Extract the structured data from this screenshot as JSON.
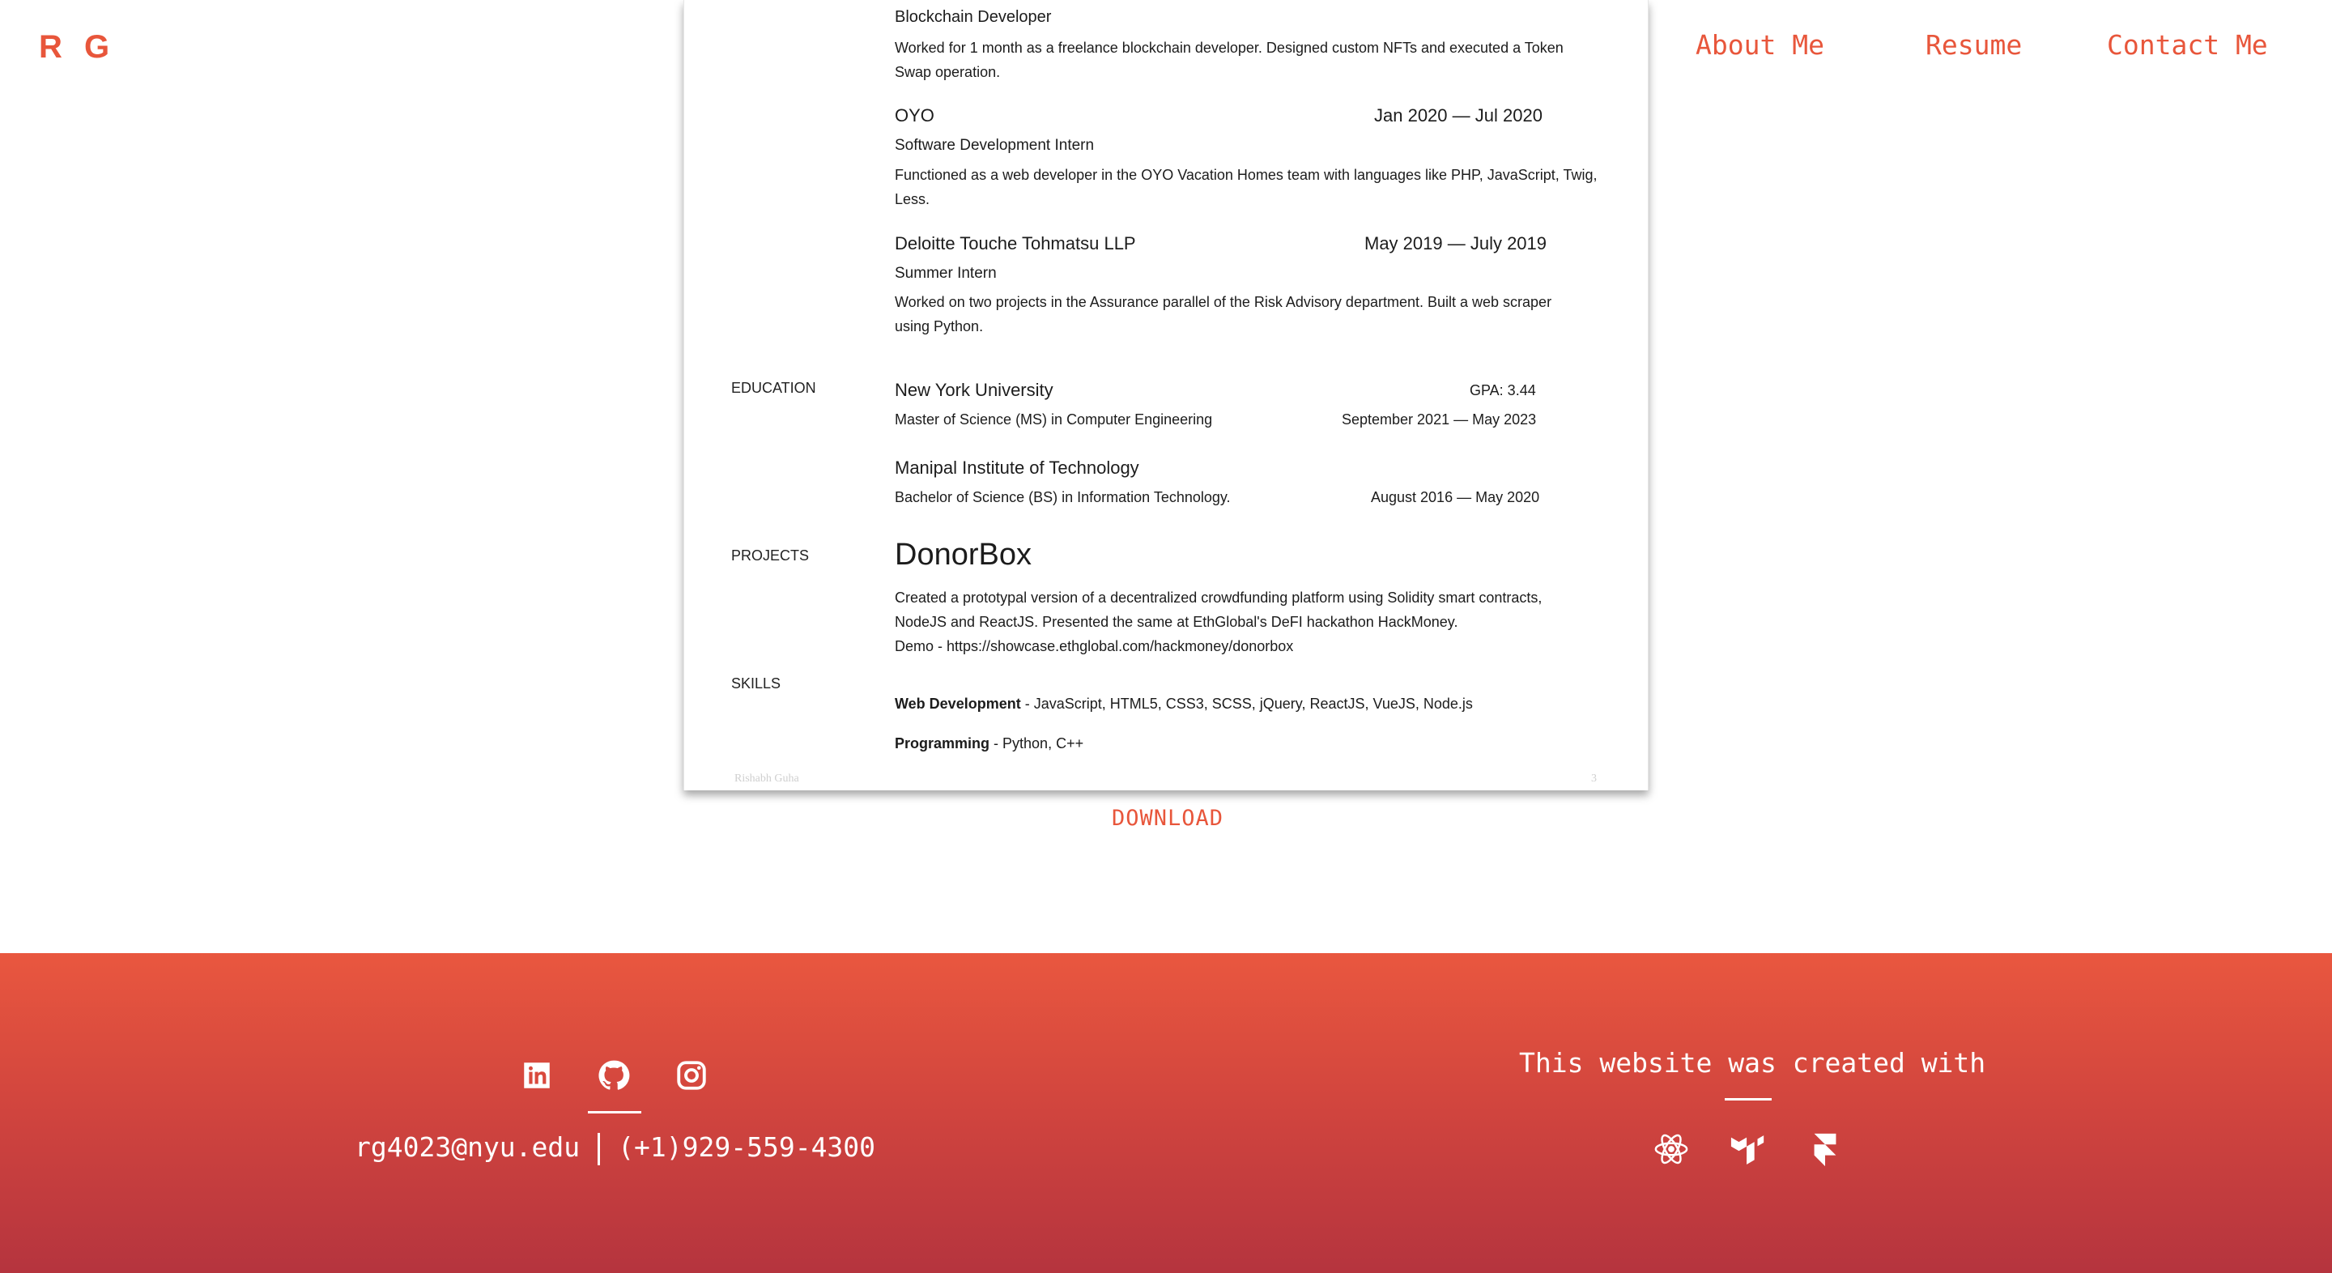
{
  "header": {
    "logo": "R G",
    "nav": [
      "About Me",
      "Resume",
      "Contact Me"
    ]
  },
  "resume": {
    "exp_blockchain": {
      "title": "Blockchain Developer",
      "desc": "Worked for 1 month as a freelance blockchain developer. Designed custom NFTs and executed a Token Swap operation."
    },
    "exp_oyo": {
      "company": "OYO",
      "dates": "Jan 2020 — Jul 2020",
      "title": "Software Development Intern",
      "desc": "Functioned as a web developer in the OYO Vacation Homes team with languages like PHP, JavaScript, Twig, Less."
    },
    "exp_deloitte": {
      "company": "Deloitte Touche Tohmatsu LLP",
      "dates": "May 2019 — July 2019",
      "title": "Summer Intern",
      "desc": "Worked on two projects in the Assurance parallel of the Risk Advisory department. Built a web scraper using Python."
    },
    "education_label": "EDUCATION",
    "edu_nyu": {
      "school": "New York University",
      "gpa": "GPA: 3.44",
      "degree": "Master of Science (MS) in Computer Engineering",
      "dates": "September 2021 — May 2023"
    },
    "edu_manipal": {
      "school": "Manipal Institute of Technology",
      "degree": "Bachelor of Science (BS) in Information Technology.",
      "dates": "August 2016 — May 2020"
    },
    "projects_label": "PROJECTS",
    "project": {
      "name": "DonorBox",
      "line1": "Created a prototypal version of a decentralized crowdfunding platform using Solidity smart contracts,",
      "line2": "NodeJS and ReactJS. Presented the same at EthGlobal's DeFI hackathon HackMoney.",
      "line3": "Demo - https://showcase.ethglobal.com/hackmoney/donorbox"
    },
    "skills_label": "SKILLS",
    "skills": {
      "web_label": "Web Development",
      "web_value": " - JavaScript, HTML5, CSS3, SCSS, jQuery, ReactJS, VueJS, Node.js",
      "prog_label": "Programming",
      "prog_value": " - Python, C++"
    },
    "footer_name": "Rishabh Guha",
    "footer_page": "3"
  },
  "download_label": "DOWNLOAD",
  "footer": {
    "social_icons": [
      "linkedin-icon",
      "github-icon",
      "instagram-icon"
    ],
    "email": "rg4023@nyu.edu",
    "phone": "(+1)929-559-4300",
    "created_with": "This website was created with",
    "tech_icons": [
      "react-icon",
      "mui-icon",
      "framer-icon"
    ]
  },
  "colors": {
    "accent": "#e8563b",
    "footer_top": "#e9573f",
    "footer_bottom": "#b5343e"
  }
}
